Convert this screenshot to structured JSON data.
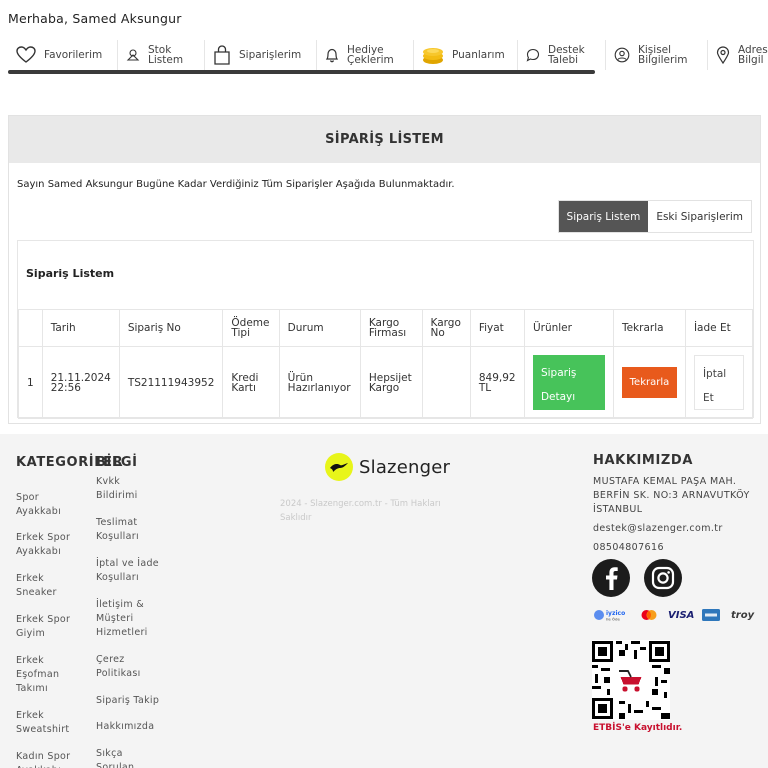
{
  "greeting": "Merhaba, Samed Aksungur",
  "nav": [
    {
      "icon": "heart-icon",
      "label": "Favorilerim"
    },
    {
      "icon": "stock-icon",
      "label": "Stok Listem"
    },
    {
      "icon": "bag-icon",
      "label": "Siparişlerim"
    },
    {
      "icon": "bell-icon",
      "label": "Hediye Çeklerim"
    },
    {
      "icon": "coins-icon",
      "label": "Puanlarım"
    },
    {
      "icon": "chat-icon",
      "label": "Destek Talebi"
    },
    {
      "icon": "user-icon",
      "label": "Kişisel Bilgilerim"
    },
    {
      "icon": "location-icon",
      "label": "Adres Bilgil"
    }
  ],
  "orders_panel": {
    "title": "SİPARİŞ LİSTEM",
    "intro": "Sayın Samed Aksungur Bugüne Kadar Verdiğiniz Tüm Siparişler Aşağıda Bulunmaktadır.",
    "tab_active": "Sipariş Listem",
    "tab_inactive": "Eski Siparişlerim",
    "list_title": "Sipariş Listem",
    "columns": [
      "",
      "Tarih",
      "Sipariş No",
      "Ödeme Tipi",
      "Durum",
      "Kargo Firması",
      "Kargo No",
      "Fiyat",
      "Ürünler",
      "Tekrarla",
      "İade Et"
    ],
    "rows": [
      {
        "index": "1",
        "date": "21.11.2024 22:56",
        "order_no": "TS21111943952",
        "payment": "Kredi Kartı",
        "status": "Ürün Hazırlanıyor",
        "carrier": "Hepsijet Kargo",
        "tracking_no": "",
        "price": "849,92 TL",
        "detail_button": "Sipariş Detayı",
        "repeat_button": "Tekrarla",
        "cancel_button": "İptal Et"
      }
    ]
  },
  "footer": {
    "categories": {
      "heading": "KATEGORİLER",
      "links": [
        "Spor Ayakkabı",
        "Erkek Spor Ayakkabı",
        "Erkek Sneaker",
        "Erkek Spor Giyim",
        "Erkek Eşofman Takımı",
        "Erkek Sweatshirt",
        "Kadın Spor Ayakkabı"
      ]
    },
    "info": {
      "heading": "BİLGİ",
      "links": [
        "Kvkk Bildirimi",
        "Teslimat Koşulları",
        "İptal ve İade Koşulları",
        "İletişim & Müşteri Hizmetleri",
        "Çerez Politikası",
        "Sipariş Takip",
        "Hakkımızda",
        "Sıkça Sorulan"
      ]
    },
    "brand": "Slazenger",
    "copyright": "2024 - Slazenger.com.tr - Tüm Hakları Saklıdır",
    "about": {
      "heading": "HAKKIMIZDA",
      "address_line1": "MUSTAFA KEMAL PAŞA MAH.",
      "address_line2": "BERFİN SK. NO:3 ARNAVUTKÖY",
      "address_line3": "İSTANBUL",
      "email": "destek@slazenger.com.tr",
      "phone": "08504807616"
    },
    "social": [
      "facebook-icon",
      "instagram-icon"
    ],
    "payments": [
      "iyzico",
      "mastercard",
      "VISA",
      "amex",
      "troy"
    ],
    "etbis": "ETBİS'e Kayıtlıdır."
  },
  "colors": {
    "detail_green": "#47c35a",
    "repeat_orange": "#e85a1c",
    "tab_dark": "#555555",
    "logo_yellow": "#e8f51a"
  }
}
